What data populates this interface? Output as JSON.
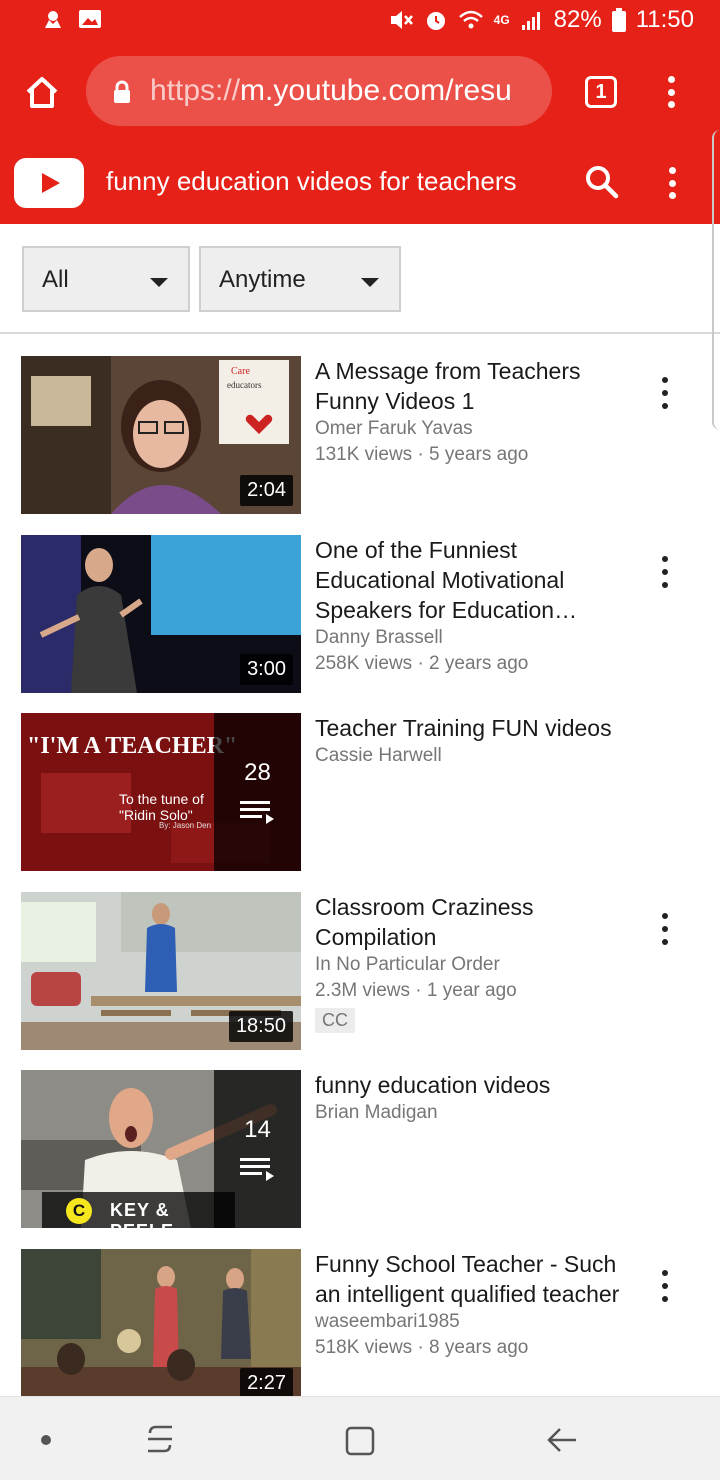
{
  "status_bar": {
    "battery": "82%",
    "time": "11:50",
    "network": "4G"
  },
  "browser": {
    "url_scheme": "https://",
    "url_host": "m.youtube.com/resu",
    "tab_count": "1"
  },
  "youtube": {
    "search_query": "funny education videos for teachers"
  },
  "filters": {
    "type": "All",
    "time": "Anytime"
  },
  "results": [
    {
      "title": "A Message from Teachers Funny Videos 1",
      "channel": "Omer Faruk Yavas",
      "views": "131K views · 5 years ago",
      "duration": "2:04",
      "kind": "video"
    },
    {
      "title": "One of the Funniest Educational Motivational Speakers for Education…",
      "channel": "Danny Brassell",
      "views": "258K views · 2 years ago",
      "duration": "3:00",
      "kind": "video"
    },
    {
      "title": "Teacher Training FUN videos",
      "channel": "Cassie Harwell",
      "playlist_count": "28",
      "kind": "playlist",
      "thumb_text": "\"I'M A TEACHER\"",
      "thumb_subtext": "To the tune of \"Ridin Solo\"",
      "thumb_credit": "By: Jason Den"
    },
    {
      "title": "Classroom Craziness Compilation",
      "channel": "In No Particular Order",
      "views": "2.3M views · 1 year ago",
      "duration": "18:50",
      "badge": "CC",
      "kind": "video"
    },
    {
      "title": "funny education videos",
      "channel": "Brian Madigan",
      "playlist_count": "14",
      "kind": "playlist",
      "thumb_logo": "KEY & PEELE"
    },
    {
      "title": "Funny School Teacher - Such an intelligent qualified teacher",
      "channel": "waseembari1985",
      "views": "518K views · 8 years ago",
      "duration": "2:27",
      "kind": "video"
    }
  ],
  "colors": {
    "brand_red": "#e62117",
    "text_primary": "#1a1a1a",
    "text_secondary": "#767676"
  }
}
